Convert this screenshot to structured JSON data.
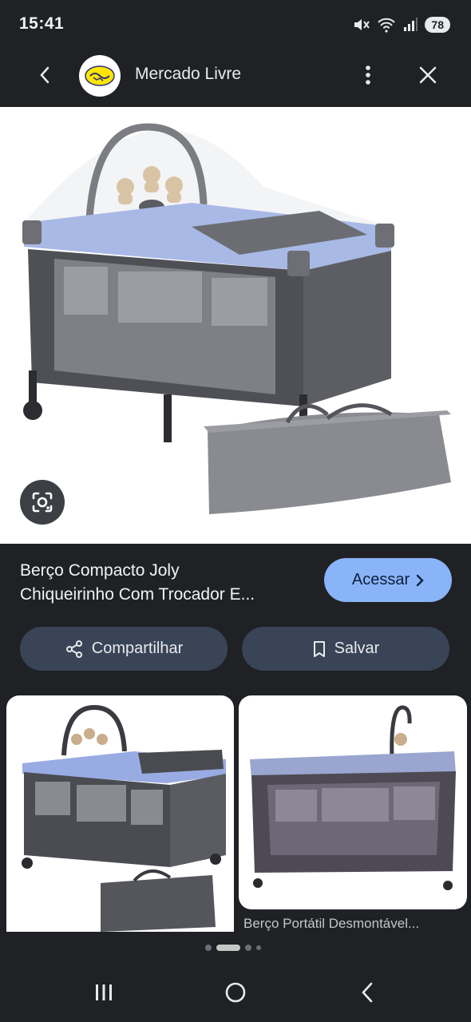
{
  "status_bar": {
    "time": "15:41",
    "battery": "78"
  },
  "app_bar": {
    "title": "Mercado Livre",
    "back_icon": "chevron-left-icon",
    "more_icon": "more-vert-icon",
    "close_icon": "close-icon"
  },
  "product": {
    "title_line1": "Berço Compacto Joly",
    "title_line2": "Chiqueirinho Com Trocador E...",
    "access_label": "Acessar"
  },
  "actions": {
    "share_label": "Compartilhar",
    "save_label": "Salvar"
  },
  "related": {
    "card2_caption": "Berço Portátil Desmontável..."
  },
  "pagination": {
    "count": 4,
    "active_index": 1
  },
  "colors": {
    "background": "#1f2125",
    "accent": "#8ab4f8",
    "button_secondary": "#394457"
  }
}
